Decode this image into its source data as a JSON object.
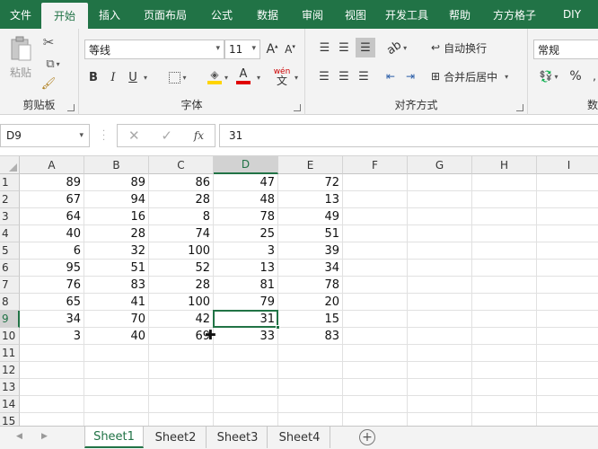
{
  "menu": {
    "items": [
      "文件",
      "开始",
      "插入",
      "页面布局",
      "公式",
      "数据",
      "审阅",
      "视图",
      "开发工具",
      "帮助",
      "方方格子",
      "DIY"
    ],
    "active": "开始"
  },
  "ribbon": {
    "clipboard": {
      "label": "剪贴板",
      "paste": "粘贴"
    },
    "font": {
      "label": "字体",
      "family": "等线",
      "size": "11",
      "bold": "B",
      "italic": "I",
      "underline": "U",
      "phonetic": "wén"
    },
    "alignment": {
      "label": "对齐方式",
      "wrap": "自动换行",
      "merge": "合并后居中"
    },
    "number": {
      "label": "数字",
      "format": "常规",
      "percent": "%"
    }
  },
  "formula_bar": {
    "name_box": "D9",
    "fx": "fx",
    "value": "31"
  },
  "columns": [
    "A",
    "B",
    "C",
    "D",
    "E",
    "F",
    "G",
    "H",
    "I"
  ],
  "selected_column": "D",
  "rows": [
    {
      "n": "1",
      "v": [
        "89",
        "89",
        "86",
        "47",
        "72"
      ]
    },
    {
      "n": "2",
      "v": [
        "67",
        "94",
        "28",
        "48",
        "13"
      ]
    },
    {
      "n": "3",
      "v": [
        "64",
        "16",
        "8",
        "78",
        "49"
      ]
    },
    {
      "n": "4",
      "v": [
        "40",
        "28",
        "74",
        "25",
        "51"
      ]
    },
    {
      "n": "5",
      "v": [
        "6",
        "32",
        "100",
        "3",
        "39"
      ]
    },
    {
      "n": "6",
      "v": [
        "95",
        "51",
        "52",
        "13",
        "34"
      ]
    },
    {
      "n": "7",
      "v": [
        "76",
        "83",
        "28",
        "81",
        "78"
      ]
    },
    {
      "n": "8",
      "v": [
        "65",
        "41",
        "100",
        "79",
        "20"
      ]
    },
    {
      "n": "9",
      "v": [
        "34",
        "70",
        "42",
        "31",
        "15"
      ]
    },
    {
      "n": "10",
      "v": [
        "3",
        "40",
        "69",
        "33",
        "83"
      ]
    },
    {
      "n": "11",
      "v": []
    },
    {
      "n": "12",
      "v": []
    },
    {
      "n": "13",
      "v": []
    },
    {
      "n": "14",
      "v": []
    },
    {
      "n": "15",
      "v": []
    }
  ],
  "selected_row": "9",
  "sheets": [
    "Sheet1",
    "Sheet2",
    "Sheet3",
    "Sheet4"
  ],
  "active_sheet": "Sheet1",
  "add_sheet": "+",
  "colors": {
    "accent": "#217346",
    "fill": "#ffd400",
    "font": "#e00000"
  }
}
